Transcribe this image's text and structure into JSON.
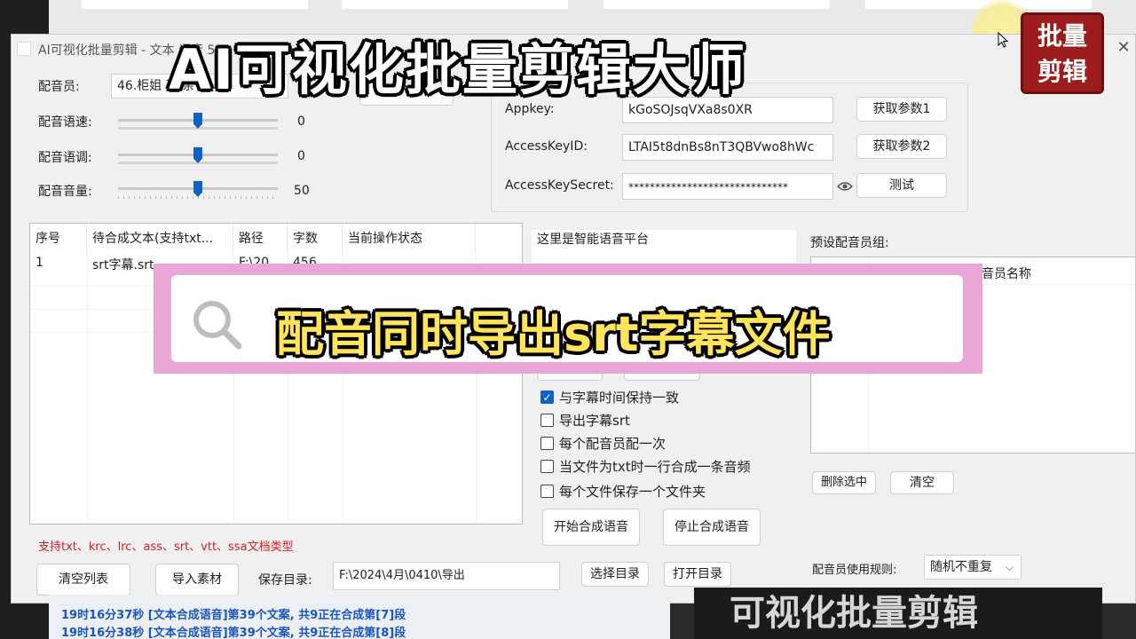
{
  "window": {
    "title": "AI可视化批量剪辑 - 文本 语音 55",
    "close": "✕"
  },
  "overlay": {
    "title": "AI可视化批量剪辑大师",
    "search_caption": "配音同时导出srt字幕文件",
    "seal_line1": "批量",
    "seal_line2": "剪辑"
  },
  "voice": {
    "speaker_label": "配音员:",
    "speaker_value": "46.柜姐 直 亲 女",
    "speed_label": "配音语速:",
    "speed_value": "0",
    "speed_level": 0.5,
    "pitch_label": "配音语调:",
    "pitch_value": "0",
    "pitch_level": 0.5,
    "volume_label": "配音音量:",
    "volume_value": "50",
    "volume_level": 0.5
  },
  "credentials": {
    "appkey_label": "Appkey:",
    "appkey_value": "kGoSOJsqVXa8s0XR",
    "accesskeyid_label": "AccessKeyID:",
    "accesskeyid_value": "LTAI5t8dnBs8nT3QBVwo8hWc",
    "secret_label": "AccessKeySecret:",
    "secret_value": "******************************",
    "get_param1": "获取参数1",
    "get_param2": "获取参数2",
    "test": "测试"
  },
  "table": {
    "headers": [
      "序号",
      "待合成文本(支持txt...",
      "路径",
      "字数",
      "当前操作状态"
    ],
    "rows": [
      [
        "1",
        "srt字幕.srt",
        "F:\\20",
        "456",
        ""
      ]
    ]
  },
  "support_text": "支持txt、krc、lrc、ass、srt、vtt、ssa文档类型",
  "platform_text": "这里是智能语音平台",
  "options": [
    {
      "label": "与字幕时间保持一致",
      "checked": true
    },
    {
      "label": "导出字幕srt",
      "checked": false
    },
    {
      "label": "每个配音员配一次",
      "checked": false
    },
    {
      "label": "当文件为txt时一行合成一条音频",
      "checked": false
    },
    {
      "label": "每个文件保存一个文件夹",
      "checked": false
    }
  ],
  "actions": {
    "start": "开始合成语音",
    "stop": "停止合成语音",
    "clear_list": "清空列表",
    "import": "导入素材",
    "save_dir_label": "保存目录:",
    "save_dir_value": "F:\\2024\\4月\\0410\\导出",
    "choose_dir": "选择目录",
    "open_dir": "打开目录"
  },
  "preset": {
    "label": "预设配音员组:",
    "column": "音员名称",
    "delete": "删除选中",
    "clear": "清空",
    "rule_label": "配音员使用规则:",
    "rule_value": "随机不重复"
  },
  "log": [
    "19时16分37秒 [文本合成语音]第39个文案, 共9正在合成第[7]段",
    "19时16分38秒 [文本合成语音]第39个文案, 共9正在合成第[8]段"
  ],
  "banner_text": "可视化批量剪辑"
}
